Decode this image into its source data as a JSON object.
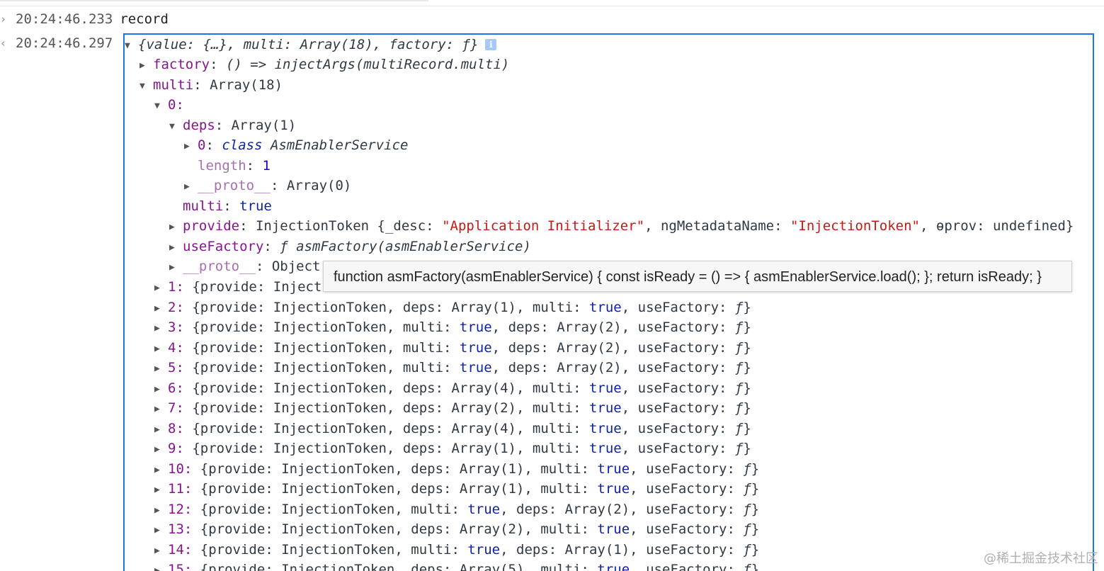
{
  "console": {
    "entries": [
      {
        "timestamp": "20:24:46.233",
        "text": "record"
      },
      {
        "timestamp": "20:24:46.297"
      }
    ],
    "object": {
      "summary": "{value: {…}, multi: Array(18), factory: ƒ}",
      "info_badge": "i",
      "factory": {
        "key": "factory",
        "value": "() => injectArgs(multiRecord.multi)"
      },
      "multi": {
        "key": "multi",
        "value": "Array(18)"
      },
      "item0": {
        "key": "0:",
        "deps": {
          "key": "deps",
          "value": "Array(1)"
        },
        "deps0": {
          "key": "0",
          "keyword": "class",
          "value": "AsmEnablerService"
        },
        "length": {
          "key": "length",
          "value": "1"
        },
        "proto_deps": {
          "key": "__proto__",
          "value": "Array(0)"
        },
        "multi": {
          "key": "multi",
          "value": "true"
        },
        "provide": {
          "key": "provide",
          "prefix": "InjectionToken {_desc: ",
          "desc": "\"Application Initializer\"",
          "mid": ", ngMetadataName: ",
          "meta": "\"InjectionToken\"",
          "tail": ", ɵprov: undefined}"
        },
        "useFactory": {
          "key": "useFactory",
          "value": "ƒ asmFactory(asmEnablerService)"
        },
        "proto": {
          "key": "__proto__",
          "value": "Object"
        }
      },
      "items": [
        {
          "idx": "1:",
          "a_key": "provide",
          "a_val": "Inject",
          "b_key": "",
          "b_val": "",
          "c_key": "",
          "c_val": "",
          "d_key": "",
          "d_val": ""
        },
        {
          "idx": "2:",
          "a_key": "provide",
          "a_val": "InjectionToken",
          "b_key": "deps",
          "b_val": "Array(1)",
          "c_key": "multi",
          "c_val": "true",
          "d_key": "useFactory",
          "d_val": "ƒ"
        },
        {
          "idx": "3:",
          "a_key": "provide",
          "a_val": "InjectionToken",
          "b_key": "multi",
          "b_val": "true",
          "c_key": "deps",
          "c_val": "Array(2)",
          "d_key": "useFactory",
          "d_val": "ƒ"
        },
        {
          "idx": "4:",
          "a_key": "provide",
          "a_val": "InjectionToken",
          "b_key": "multi",
          "b_val": "true",
          "c_key": "deps",
          "c_val": "Array(2)",
          "d_key": "useFactory",
          "d_val": "ƒ"
        },
        {
          "idx": "5:",
          "a_key": "provide",
          "a_val": "InjectionToken",
          "b_key": "multi",
          "b_val": "true",
          "c_key": "deps",
          "c_val": "Array(2)",
          "d_key": "useFactory",
          "d_val": "ƒ"
        },
        {
          "idx": "6:",
          "a_key": "provide",
          "a_val": "InjectionToken",
          "b_key": "deps",
          "b_val": "Array(4)",
          "c_key": "multi",
          "c_val": "true",
          "d_key": "useFactory",
          "d_val": "ƒ"
        },
        {
          "idx": "7:",
          "a_key": "provide",
          "a_val": "InjectionToken",
          "b_key": "deps",
          "b_val": "Array(2)",
          "c_key": "multi",
          "c_val": "true",
          "d_key": "useFactory",
          "d_val": "ƒ"
        },
        {
          "idx": "8:",
          "a_key": "provide",
          "a_val": "InjectionToken",
          "b_key": "deps",
          "b_val": "Array(4)",
          "c_key": "multi",
          "c_val": "true",
          "d_key": "useFactory",
          "d_val": "ƒ"
        },
        {
          "idx": "9:",
          "a_key": "provide",
          "a_val": "InjectionToken",
          "b_key": "deps",
          "b_val": "Array(1)",
          "c_key": "multi",
          "c_val": "true",
          "d_key": "useFactory",
          "d_val": "ƒ"
        },
        {
          "idx": "10:",
          "a_key": "provide",
          "a_val": "InjectionToken",
          "b_key": "deps",
          "b_val": "Array(1)",
          "c_key": "multi",
          "c_val": "true",
          "d_key": "useFactory",
          "d_val": "ƒ"
        },
        {
          "idx": "11:",
          "a_key": "provide",
          "a_val": "InjectionToken",
          "b_key": "deps",
          "b_val": "Array(1)",
          "c_key": "multi",
          "c_val": "true",
          "d_key": "useFactory",
          "d_val": "ƒ"
        },
        {
          "idx": "12:",
          "a_key": "provide",
          "a_val": "InjectionToken",
          "b_key": "multi",
          "b_val": "true",
          "c_key": "deps",
          "c_val": "Array(2)",
          "d_key": "useFactory",
          "d_val": "ƒ"
        },
        {
          "idx": "13:",
          "a_key": "provide",
          "a_val": "InjectionToken",
          "b_key": "deps",
          "b_val": "Array(2)",
          "c_key": "multi",
          "c_val": "true",
          "d_key": "useFactory",
          "d_val": "ƒ"
        },
        {
          "idx": "14:",
          "a_key": "provide",
          "a_val": "InjectionToken",
          "b_key": "multi",
          "b_val": "true",
          "c_key": "deps",
          "c_val": "Array(1)",
          "d_key": "useFactory",
          "d_val": "ƒ"
        },
        {
          "idx": "15:",
          "a_key": "provide",
          "a_val": "InjectionToken",
          "b_key": "deps",
          "b_val": "Array(5)",
          "c_key": "multi",
          "c_val": "true",
          "d_key": "useFactory",
          "d_val": "ƒ"
        }
      ]
    },
    "tooltip": "function asmFactory(asmEnablerService) { const isReady = () => { asmEnablerService.load(); }; return isReady; }"
  },
  "watermark": "@稀土掘金技术社区"
}
